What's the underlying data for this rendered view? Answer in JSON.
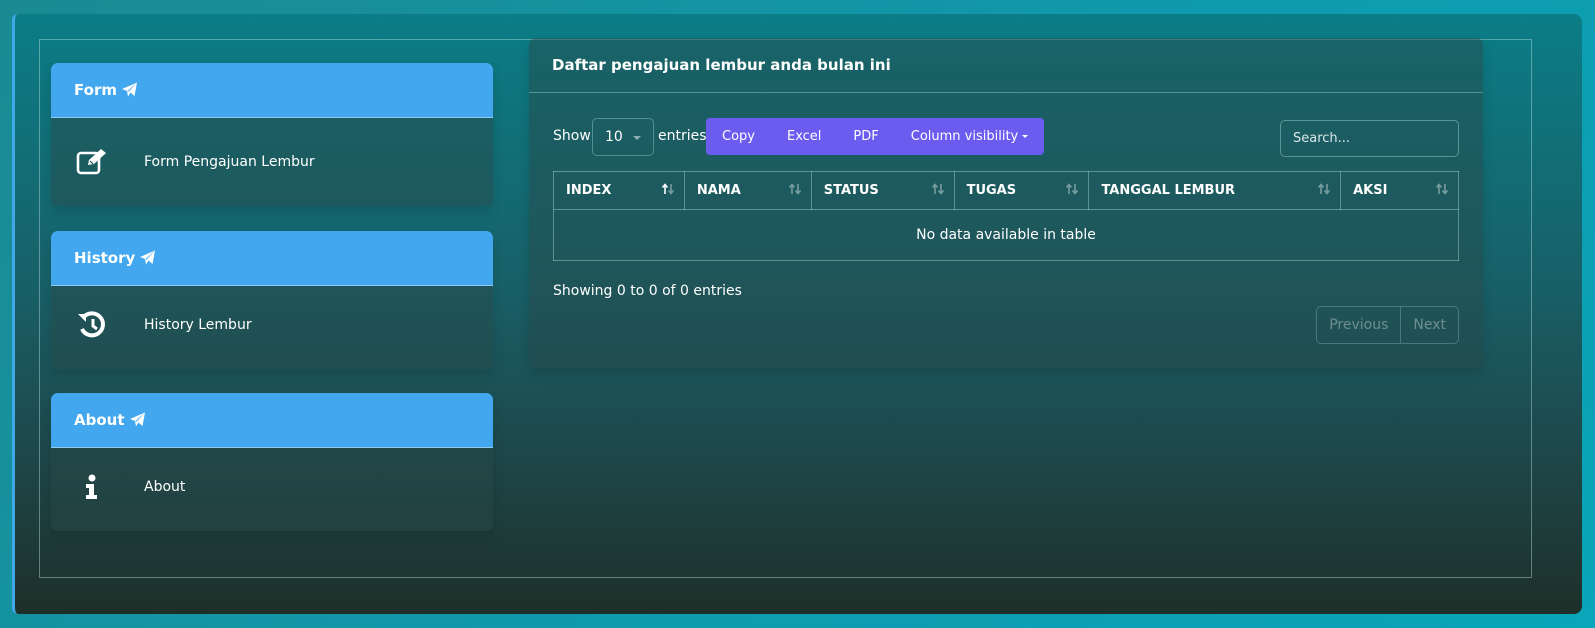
{
  "sidebar": {
    "cards": [
      {
        "header": "Form",
        "item_label": "Form Pengajuan Lembur",
        "icon": "edit-icon"
      },
      {
        "header": "History",
        "item_label": "History Lembur",
        "icon": "history-icon"
      },
      {
        "header": "About",
        "item_label": "About",
        "icon": "info-icon"
      }
    ],
    "header_icon": "paper-plane-icon"
  },
  "main": {
    "title": "Daftar pengajuan lembur anda bulan ini",
    "length": {
      "show_label": "Show",
      "value": "10",
      "entries_label": "entries"
    },
    "buttons": {
      "copy": "Copy",
      "excel": "Excel",
      "pdf": "PDF",
      "colvis": "Column visibility"
    },
    "search": {
      "placeholder": "Search..."
    },
    "table": {
      "columns": [
        "INDEX",
        "NAMA",
        "STATUS",
        "TUGAS",
        "TANGGAL LEMBUR",
        "AKSI"
      ],
      "sorted_column": "INDEX",
      "empty_message": "No data available in table"
    },
    "info": "Showing 0 to 0 of 0 entries",
    "pagination": {
      "previous": "Previous",
      "next": "Next"
    }
  },
  "colors": {
    "card_header": "#42a7ee",
    "button_group": "#6b5cf0",
    "frame_accent": "#3fa9e8"
  }
}
